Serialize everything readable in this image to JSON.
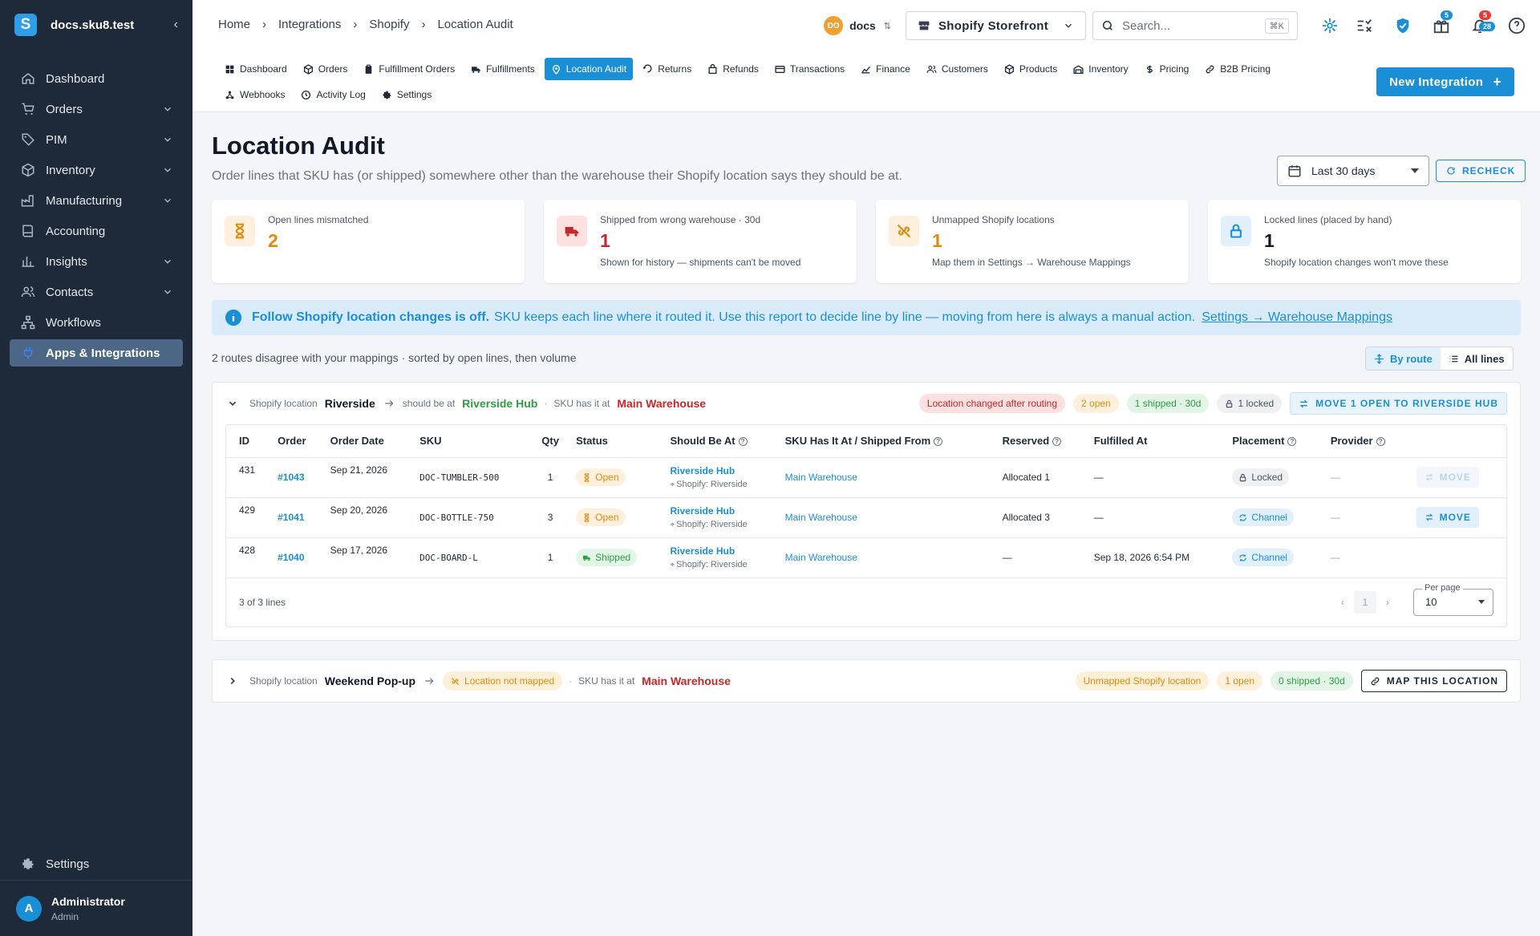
{
  "sidebar": {
    "title": "docs.sku8.test",
    "items": [
      {
        "label": "Dashboard",
        "icon": "home-icon",
        "expandable": false
      },
      {
        "label": "Orders",
        "icon": "cart-icon",
        "expandable": true
      },
      {
        "label": "PIM",
        "icon": "tag-icon",
        "expandable": true
      },
      {
        "label": "Inventory",
        "icon": "box-icon",
        "expandable": true
      },
      {
        "label": "Manufacturing",
        "icon": "factory-icon",
        "expandable": true
      },
      {
        "label": "Accounting",
        "icon": "book-icon",
        "expandable": false
      },
      {
        "label": "Insights",
        "icon": "chart-icon",
        "expandable": true
      },
      {
        "label": "Contacts",
        "icon": "people-icon",
        "expandable": true
      },
      {
        "label": "Workflows",
        "icon": "workflow-icon",
        "expandable": false
      },
      {
        "label": "Apps & Integrations",
        "icon": "plug-icon",
        "expandable": false,
        "active": true
      }
    ],
    "settings_label": "Settings",
    "user": {
      "initial": "A",
      "name": "Administrator",
      "role": "Admin"
    }
  },
  "breadcrumbs": [
    "Home",
    "Integrations",
    "Shopify",
    "Location Audit"
  ],
  "topbar": {
    "account_initials": "DO",
    "account_name": "docs",
    "store_name": "Shopify Storefront",
    "search_placeholder": "Search...",
    "search_shortcut": "⌘K",
    "gift_badge": "5",
    "notif_badge_top": "5",
    "notif_badge_bottom": "28"
  },
  "tabs_row1": [
    {
      "label": "Dashboard",
      "icon": "grid-icon"
    },
    {
      "label": "Orders",
      "icon": "cube-icon"
    },
    {
      "label": "Fulfillment Orders",
      "icon": "clipboard-icon"
    },
    {
      "label": "Fulfillments",
      "icon": "truck-icon"
    },
    {
      "label": "Location Audit",
      "icon": "pin-icon",
      "active": true
    },
    {
      "label": "Returns",
      "icon": "return-icon"
    },
    {
      "label": "Refunds",
      "icon": "refund-icon"
    },
    {
      "label": "Transactions",
      "icon": "card-icon"
    },
    {
      "label": "Finance",
      "icon": "finance-icon"
    },
    {
      "label": "Customers",
      "icon": "people-icon"
    },
    {
      "label": "Products",
      "icon": "cube-icon"
    },
    {
      "label": "Inventory",
      "icon": "warehouse-icon"
    },
    {
      "label": "Pricing",
      "icon": "dollar-icon"
    },
    {
      "label": "B2B Pricing",
      "icon": "link-icon"
    }
  ],
  "tabs_row2": [
    {
      "label": "Webhooks",
      "icon": "webhook-icon"
    },
    {
      "label": "Activity Log",
      "icon": "history-icon"
    },
    {
      "label": "Settings",
      "icon": "gear-icon"
    }
  ],
  "new_integration_label": "New Integration",
  "page": {
    "title": "Location Audit",
    "subtitle": "Order lines that SKU has (or shipped) somewhere other than the warehouse their Shopify location says they should be at.",
    "range_label": "Last 30 days",
    "recheck_label": "RECHECK"
  },
  "stats": [
    {
      "label": "Open lines mismatched",
      "value": "2",
      "note": "",
      "color": "#e08a0e",
      "bg": "#fef0dc",
      "icon": "hourglass-icon"
    },
    {
      "label": "Shipped from wrong warehouse · 30d",
      "value": "1",
      "note": "Shown for history — shipments can't be moved",
      "color": "#c62828",
      "bg": "#fde0e0",
      "icon": "truck-icon"
    },
    {
      "label": "Unmapped Shopify locations",
      "value": "1",
      "note": "Map them in Settings → Warehouse Mappings",
      "color": "#e08a0e",
      "bg": "#fef0dc",
      "icon": "unlink-icon"
    },
    {
      "label": "Locked lines (placed by hand)",
      "value": "1",
      "note": "Shopify location changes won't move these",
      "color": "#111827",
      "bg": "#e1f0fb",
      "icon": "lock-icon"
    }
  ],
  "info": {
    "bold": "Follow Shopify location changes is off.",
    "text": "SKU keeps each line where it routed it. Use this report to decide line by line — moving from here is always a manual action.",
    "link": "Settings → Warehouse Mappings"
  },
  "summary": "2 routes disagree with your mappings · sorted by open lines, then volume",
  "view": {
    "by_route": "By route",
    "all_lines": "All lines"
  },
  "routes": [
    {
      "prefix": "Shopify location",
      "location": "Riverside",
      "should_label": "should be at",
      "should_be": "Riverside Hub",
      "has_label": "SKU has it at",
      "has_at": "Main Warehouse",
      "chips": [
        "Location changed after routing",
        "2 open",
        "1 shipped · 30d",
        "1 locked"
      ],
      "action": "MOVE 1 OPEN TO RIVERSIDE HUB"
    },
    {
      "prefix": "Shopify location",
      "location": "Weekend Pop-up",
      "not_mapped": "Location not mapped",
      "has_label": "SKU has it at",
      "has_at": "Main Warehouse",
      "chips": [
        "Unmapped Shopify location",
        "1 open",
        "0 shipped · 30d"
      ],
      "action": "MAP THIS LOCATION"
    }
  ],
  "table": {
    "headers": [
      "ID",
      "Order",
      "Order Date",
      "SKU",
      "Qty",
      "Status",
      "Should Be At",
      "SKU Has It At / Shipped From",
      "Reserved",
      "Fulfilled At",
      "Placement",
      "Provider",
      ""
    ],
    "rows": [
      {
        "id": "431",
        "order": "#1043",
        "date": "Sep 21, 2026",
        "sku": "DOC-TUMBLER-500",
        "qty": "1",
        "status": "Open",
        "should": "Riverside Hub",
        "should_sub": "Shopify: Riverside",
        "has": "Main Warehouse",
        "reserved": "Allocated 1",
        "fulfilled": "—",
        "placement": "Locked",
        "provider": "—",
        "action": "MOVE",
        "action_enabled": false
      },
      {
        "id": "429",
        "order": "#1041",
        "date": "Sep 20, 2026",
        "sku": "DOC-BOTTLE-750",
        "qty": "3",
        "status": "Open",
        "should": "Riverside Hub",
        "should_sub": "Shopify: Riverside",
        "has": "Main Warehouse",
        "reserved": "Allocated 3",
        "fulfilled": "—",
        "placement": "Channel",
        "provider": "—",
        "action": "MOVE",
        "action_enabled": true
      },
      {
        "id": "428",
        "order": "#1040",
        "date": "Sep 17, 2026",
        "sku": "DOC-BOARD-L",
        "qty": "1",
        "status": "Shipped",
        "should": "Riverside Hub",
        "should_sub": "Shopify: Riverside",
        "has": "Main Warehouse",
        "reserved": "—",
        "fulfilled": "Sep 18, 2026 6:54 PM",
        "placement": "Channel",
        "provider": "—",
        "action": "",
        "action_enabled": false
      }
    ],
    "count_text": "3 of 3 lines",
    "page": "1",
    "per_page_label": "Per page",
    "per_page": "10"
  }
}
